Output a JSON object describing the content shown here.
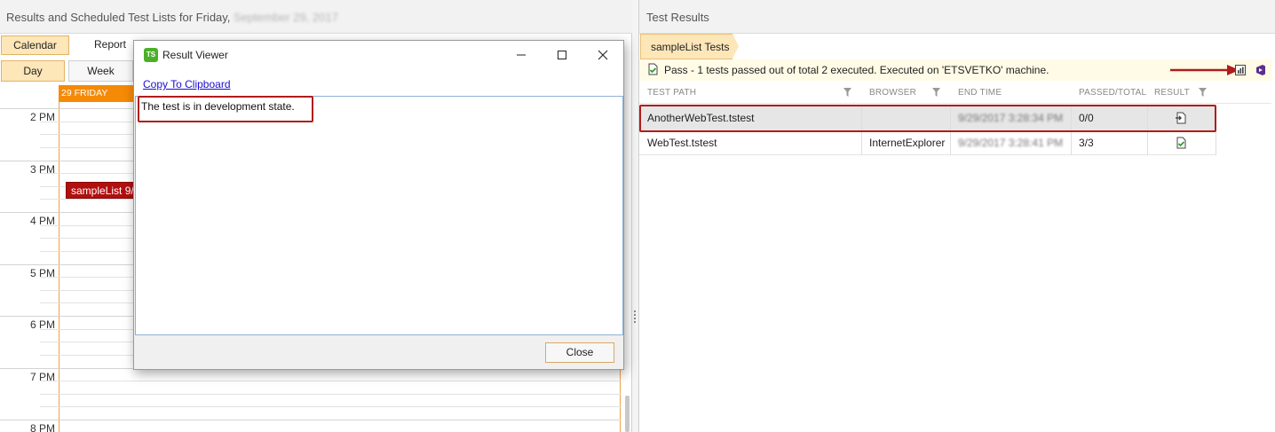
{
  "left": {
    "header_title": "Results and Scheduled Test Lists for Friday,",
    "header_date": "September 29, 2017",
    "view_tabs": [
      "Calendar",
      "Report"
    ],
    "range_tabs": [
      "Day",
      "Week"
    ],
    "day_header": "29 FRIDAY",
    "hours": [
      "2 PM",
      "3 PM",
      "4 PM",
      "5 PM",
      "6 PM",
      "7 PM",
      "8 PM"
    ],
    "event_label": "sampleList 9/"
  },
  "right": {
    "header_title": "Test Results",
    "breadcrumb": "sampleList Tests",
    "status_text": "Pass - 1 tests passed out of total 2 executed. Executed on 'ETSVETKO' machine.",
    "columns": [
      "TEST PATH",
      "BROWSER",
      "END TIME",
      "PASSED/TOTAL",
      "RESULT"
    ],
    "rows": [
      {
        "path": "AnotherWebTest.tstest",
        "browser": "",
        "end_time": "9/29/2017 3:28:34 PM",
        "passed": "0/0",
        "result_icon": "not-run-icon"
      },
      {
        "path": "WebTest.tstest",
        "browser": "InternetExplorer",
        "end_time": "9/29/2017 3:28:41 PM",
        "passed": "3/3",
        "result_icon": "pass-icon"
      }
    ]
  },
  "dialog": {
    "title": "Result Viewer",
    "logo_text": "TS",
    "copy_link": "Copy To Clipboard",
    "message": "The test is in development state.",
    "close_label": "Close"
  },
  "colors": {
    "accent_orange": "#f58a07",
    "tab_active": "#fde6b8",
    "highlight_red": "#b01c1c",
    "event_red": "#b20f0f"
  }
}
